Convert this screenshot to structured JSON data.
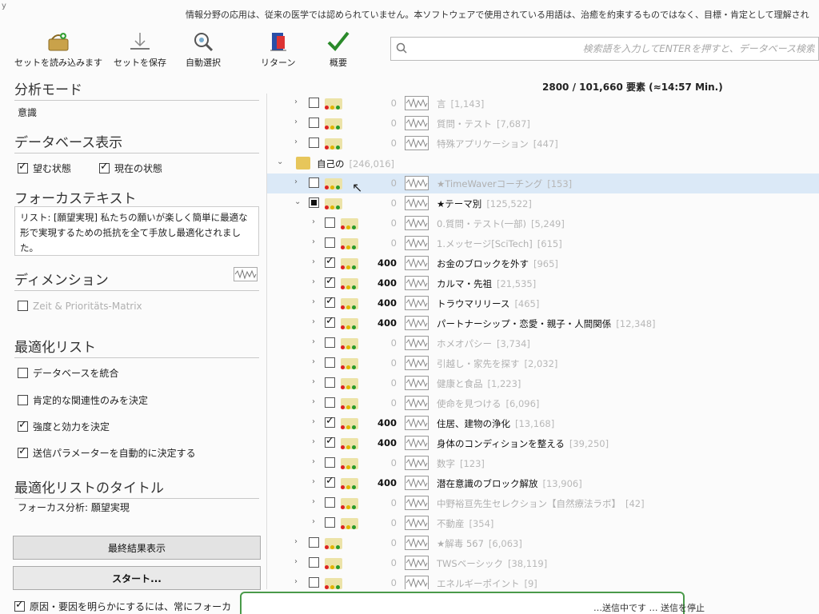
{
  "notice": {
    "text": "情報分野の応用は、従来の医学では認められていません。本ソフトウェアで使用されている用語は、治癒を約束するものではなく、目標・肯定として理解され",
    "corner": "y"
  },
  "toolbar": {
    "load": "セットを読み込みます",
    "save": "セットを保存",
    "auto": "自動選択",
    "return": "リターン",
    "overview": "概要"
  },
  "search": {
    "placeholder": "検索語を入力してENTERを押すと、データベース検索"
  },
  "left": {
    "mode_title": "分析モード",
    "mode_value": "意識",
    "db_title": "データベース表示",
    "db_opt1": "望む状態",
    "db_opt2": "現在の状態",
    "focus_title": "フォーカステキスト",
    "focus_text": "リスト: [願望実現] 私たちの願いが楽しく簡単に最適な形で実現するための抵抗を全て手放し最適化されました。",
    "dim_title": "ディメンション",
    "dim_opt": "Zeit & Prioritäts-Matrix",
    "opt_title": "最適化リスト",
    "opt1": "データベースを統合",
    "opt2": "肯定的な関連性のみを決定",
    "opt3": "強度と効力を決定",
    "opt4": "送信パラメーターを自動的に決定する",
    "opt_list_title": "最適化リストのタイトル",
    "opt_list_value": "フォーカス分析: 願望実現",
    "final_btn": "最終結果表示",
    "start_btn": "スタート...",
    "bottom_cb": "原因・要因を明らかにするには、常にフォーカ"
  },
  "stats": "2800 / 101,660 要素 (≈14:57 Min.)",
  "tree": {
    "rows": [
      {
        "level": 1,
        "name": "言",
        "count": "[1,143]",
        "num": "0",
        "checked": "off",
        "active": false
      },
      {
        "level": 1,
        "name": "質問・テスト",
        "count": "[7,687]",
        "num": "0",
        "checked": "off",
        "active": false
      },
      {
        "level": 1,
        "name": "特殊アプリケーション",
        "count": "[447]",
        "num": "0",
        "checked": "off",
        "active": false
      },
      {
        "level": 0,
        "name": "自己の",
        "count": "[246,016]",
        "folder": true
      },
      {
        "level": 1,
        "name": "★TimeWaverコーチング",
        "count": "[153]",
        "num": "0",
        "checked": "off",
        "active": false,
        "selected": true
      },
      {
        "level": 1,
        "name": "★テーマ別",
        "count": "[125,522]",
        "num": "0",
        "checked": "part",
        "active": true,
        "open": true
      },
      {
        "level": 2,
        "name": "0.質問・テスト(一部)",
        "count": "[5,249]",
        "num": "0",
        "checked": "off",
        "active": false
      },
      {
        "level": 2,
        "name": "1.メッセージ[SciTech]",
        "count": "[615]",
        "num": "0",
        "checked": "off",
        "active": false
      },
      {
        "level": 2,
        "name": "お金のブロックを外す",
        "count": "[965]",
        "num": "400",
        "checked": "on",
        "active": true
      },
      {
        "level": 2,
        "name": "カルマ・先祖",
        "count": "[21,535]",
        "num": "400",
        "checked": "on",
        "active": true
      },
      {
        "level": 2,
        "name": "トラウマリリース",
        "count": "[465]",
        "num": "400",
        "checked": "on",
        "active": true
      },
      {
        "level": 2,
        "name": "パートナーシップ・恋愛・親子・人間関係",
        "count": "[12,348]",
        "num": "400",
        "checked": "on",
        "active": true
      },
      {
        "level": 2,
        "name": "ホメオパシー",
        "count": "[3,734]",
        "num": "0",
        "checked": "off",
        "active": false
      },
      {
        "level": 2,
        "name": "引越し・家先を探す",
        "count": "[2,032]",
        "num": "0",
        "checked": "off",
        "active": false
      },
      {
        "level": 2,
        "name": "健康と食品",
        "count": "[1,223]",
        "num": "0",
        "checked": "off",
        "active": false
      },
      {
        "level": 2,
        "name": "使命を見つける",
        "count": "[6,096]",
        "num": "0",
        "checked": "off",
        "active": false
      },
      {
        "level": 2,
        "name": "住居、建物の浄化",
        "count": "[13,168]",
        "num": "400",
        "checked": "on",
        "active": true
      },
      {
        "level": 2,
        "name": "身体のコンディションを整える",
        "count": "[39,250]",
        "num": "400",
        "checked": "on",
        "active": true
      },
      {
        "level": 2,
        "name": "数字",
        "count": "[123]",
        "num": "0",
        "checked": "off",
        "active": false
      },
      {
        "level": 2,
        "name": "潜在意識のブロック解放",
        "count": "[13,906]",
        "num": "400",
        "checked": "on",
        "active": true
      },
      {
        "level": 2,
        "name": "中野裕亘先生セレクション【自然療法ラボ】",
        "count": "[42]",
        "num": "0",
        "checked": "off",
        "active": false
      },
      {
        "level": 2,
        "name": "不動産",
        "count": "[354]",
        "num": "0",
        "checked": "off",
        "active": false
      },
      {
        "level": 1,
        "name": "★解毒 567",
        "count": "[6,063]",
        "num": "0",
        "checked": "off",
        "active": false
      },
      {
        "level": 1,
        "name": "TWSベーシック",
        "count": "[38,119]",
        "num": "0",
        "checked": "off",
        "active": false
      },
      {
        "level": 1,
        "name": "エネルギーポイント",
        "count": "[9]",
        "num": "0",
        "checked": "off",
        "active": false
      }
    ]
  },
  "popup": {
    "text": "…送信中です … 送信を停止"
  }
}
